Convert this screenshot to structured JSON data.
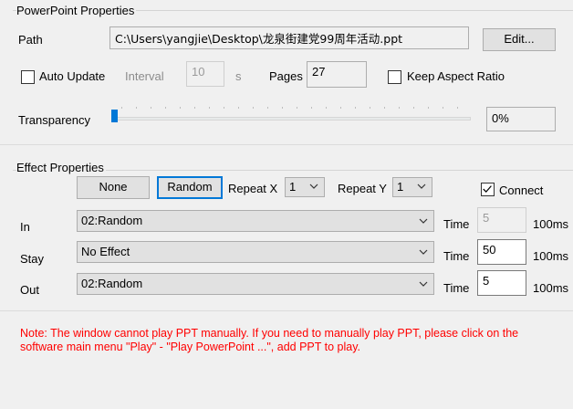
{
  "powerpoint": {
    "group_title": "PowerPoint Properties",
    "path_label": "Path",
    "path_value": "C:\\Users\\yangjie\\Desktop\\龙泉街建党99周年活动.ppt",
    "edit_label": "Edit...",
    "auto_update_label": "Auto Update",
    "auto_update_checked": false,
    "interval_label": "Interval",
    "interval_value": "10",
    "interval_unit": "s",
    "pages_label": "Pages",
    "pages_value": "27",
    "keep_aspect_label": "Keep Aspect Ratio",
    "keep_aspect_checked": false,
    "transparency_label": "Transparency",
    "transparency_value": "0%",
    "transparency_level": 0
  },
  "effect": {
    "group_title": "Effect Properties",
    "none_label": "None",
    "random_label": "Random",
    "repeat_x_label": "Repeat X",
    "repeat_x_value": "1",
    "repeat_y_label": "Repeat Y",
    "repeat_y_value": "1",
    "connect_label": "Connect",
    "connect_checked": true,
    "rows": [
      {
        "label": "In",
        "effect": "02:Random",
        "time_label": "Time",
        "time_value": "5",
        "unit": "100ms"
      },
      {
        "label": "Stay",
        "effect": "No Effect",
        "time_label": "Time",
        "time_value": "50",
        "unit": "100ms"
      },
      {
        "label": "Out",
        "effect": "02:Random",
        "time_label": "Time",
        "time_value": "5",
        "unit": "100ms"
      }
    ]
  },
  "note": "Note: The window cannot play PPT manually. If you need to manually play PPT, please click on the software main menu \"Play\" - \"Play PowerPoint ...\", add PPT to play.",
  "colors": {
    "note": "#ff0000",
    "accent": "#0078d7",
    "slider_thumb": "#0078d7"
  },
  "icons": {
    "dropdown": "chevron-down-icon",
    "checkmark": "checkmark-icon"
  }
}
